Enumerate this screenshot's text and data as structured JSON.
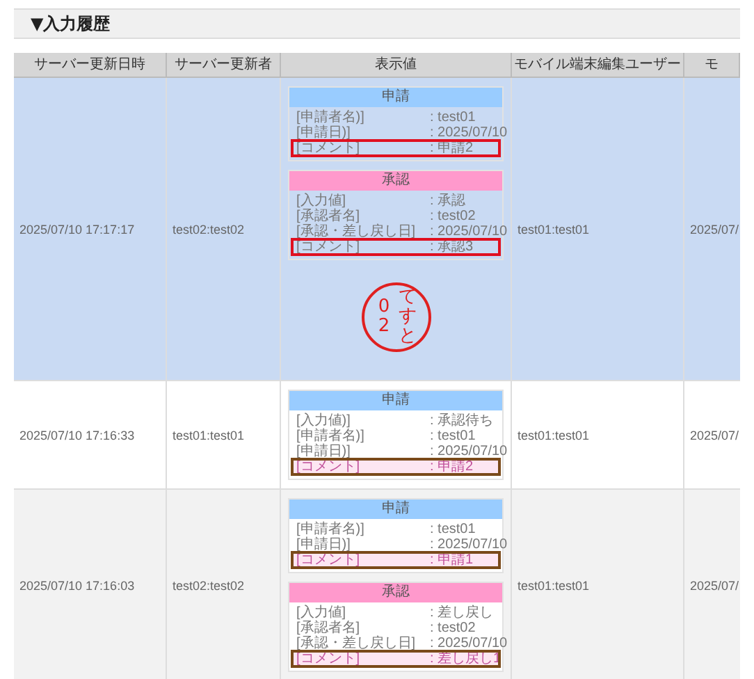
{
  "section": {
    "title": "▼入力履歴"
  },
  "table": {
    "columns": [
      "サーバー更新日時",
      "サーバー更新者",
      "表示値",
      "モバイル端末編集ユーザー",
      "モ"
    ],
    "rows": [
      {
        "selected": true,
        "updated_at": "2025/07/10 17:17:17",
        "updated_by": "test02:test02",
        "mobile_user": "test01:test01",
        "column_5": "2025/07/",
        "display": [
          {
            "kind": "application",
            "title": "申請",
            "fields": [
              {
                "label": "[申請者名)]",
                "value": ": test01",
                "highlighted": false
              },
              {
                "label": "[申請日)]",
                "value": ": 2025/07/10",
                "highlighted": false
              },
              {
                "label": "[コメント]",
                "value": ": 申請2",
                "highlighted": true,
                "color": "#e01020"
              }
            ]
          },
          {
            "kind": "approval",
            "title": "承認",
            "fields": [
              {
                "label": "[入力値]",
                "value": ": 承認",
                "highlighted": false
              },
              {
                "label": "[承認者名]",
                "value": ": test02",
                "highlighted": false
              },
              {
                "label": "[承認・差し戻し日]",
                "value": ": 2025/07/10",
                "highlighted": false
              },
              {
                "label": "[コメント]",
                "value": ": 承認3",
                "highlighted": true,
                "color": "#e01020"
              }
            ]
          }
        ],
        "stamp": {
          "number": "02",
          "name": "てすと"
        }
      },
      {
        "selected": false,
        "updated_at": "2025/07/10 17:16:33",
        "updated_by": "test01:test01",
        "mobile_user": "test01:test01",
        "column_5": "2025/07/",
        "display": [
          {
            "kind": "application",
            "title": "申請",
            "fields": [
              {
                "label": "[入力値)]",
                "value": ": 承認待ち",
                "highlighted": false
              },
              {
                "label": "[申請者名)]",
                "value": ": test01",
                "highlighted": false
              },
              {
                "label": "[申請日)]",
                "value": ": 2025/07/10",
                "highlighted": false
              },
              {
                "label": "[コメント]",
                "value": ": 申請2",
                "highlighted": true,
                "color": "#7a4a1a"
              }
            ]
          }
        ]
      },
      {
        "selected": false,
        "updated_at": "2025/07/10 17:16:03",
        "updated_by": "test02:test02",
        "mobile_user": "test01:test01",
        "column_5": "2025/07/",
        "display": [
          {
            "kind": "application",
            "title": "申請",
            "fields": [
              {
                "label": "[申請者名)]",
                "value": ": test01",
                "highlighted": false
              },
              {
                "label": "[申請日)]",
                "value": ": 2025/07/10",
                "highlighted": false
              },
              {
                "label": "[コメント]",
                "value": ": 申請1",
                "highlighted": true,
                "color": "#7a4a1a"
              }
            ]
          },
          {
            "kind": "approval",
            "title": "承認",
            "fields": [
              {
                "label": "[入力値]",
                "value": ": 差し戻し",
                "highlighted": false
              },
              {
                "label": "[承認者名]",
                "value": ": test02",
                "highlighted": false
              },
              {
                "label": "[承認・差し戻し日]",
                "value": ": 2025/07/10",
                "highlighted": false
              },
              {
                "label": "[コメント]",
                "value": ": 差し戻し1",
                "highlighted": true,
                "color": "#7a4a1a"
              }
            ]
          }
        ]
      }
    ]
  }
}
